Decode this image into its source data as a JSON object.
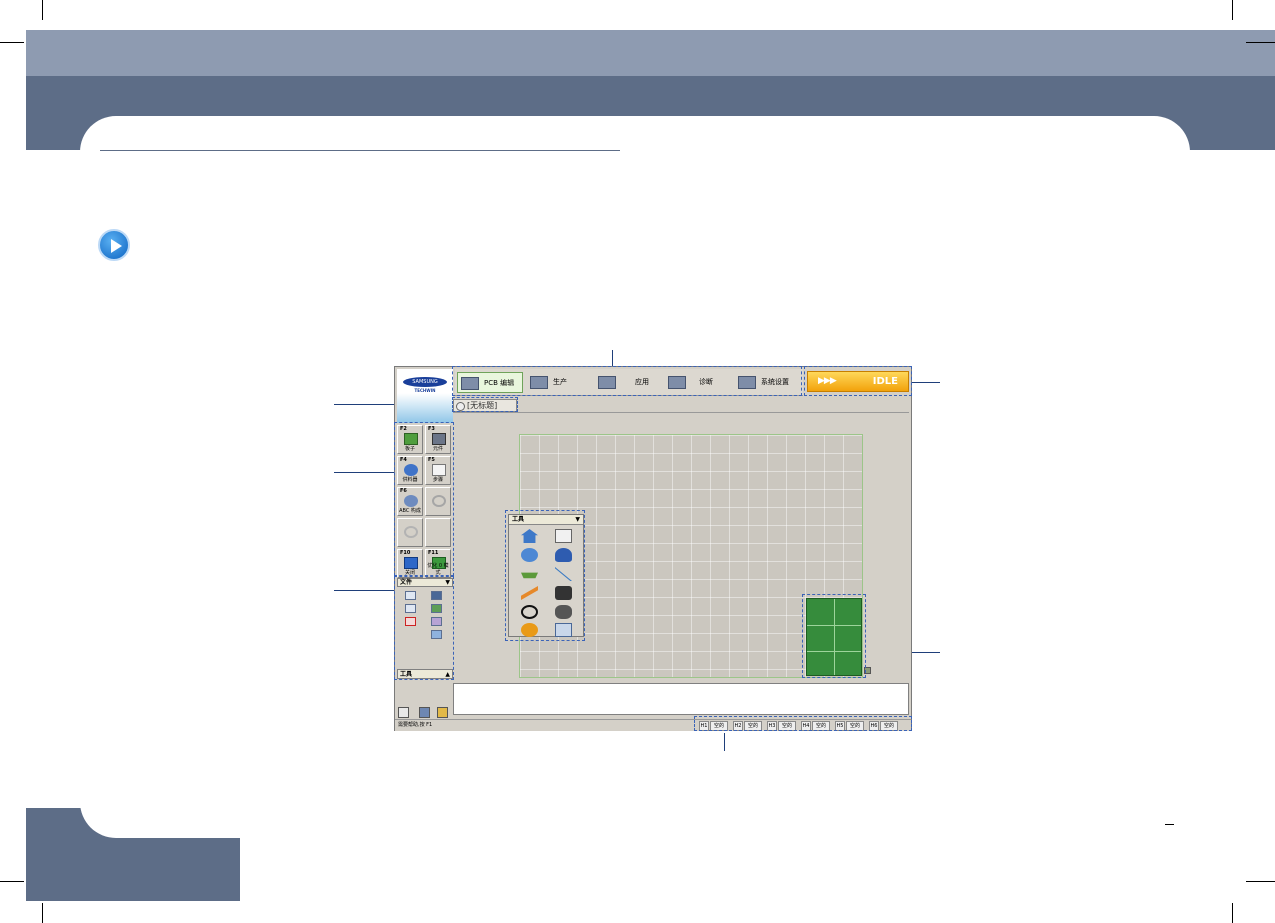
{
  "app": {
    "logo": {
      "brand": "SAMSUNG",
      "sub": "TECHWIN"
    },
    "tabs": [
      {
        "label": "PCB 编辑",
        "icon": "pcb-edit-icon",
        "active": true
      },
      {
        "label": "生产",
        "icon": "production-icon"
      },
      {
        "label": "应用",
        "icon": "application-icon"
      },
      {
        "label": "诊断",
        "icon": "diagnosis-icon"
      },
      {
        "label": "系统设置",
        "icon": "system-settings-icon"
      }
    ],
    "status_indicator": "IDLE",
    "doc_tab": "[无标题]",
    "fkeys": [
      {
        "key": "F2",
        "label": "板子",
        "icon": "board-icon"
      },
      {
        "key": "F3",
        "label": "元件",
        "icon": "part-icon"
      },
      {
        "key": "F4",
        "label": "供料器",
        "icon": "feeder-icon"
      },
      {
        "key": "F5",
        "label": "步骤",
        "icon": "step-icon"
      },
      {
        "key": "F6",
        "label": "ABC 构成",
        "icon": "abc-config-icon"
      },
      {
        "key": "F10",
        "label": "关闭",
        "icon": "close-icon"
      },
      {
        "key": "F11",
        "label": "优化 0 模式",
        "icon": "optimize-icon"
      }
    ],
    "file_panel": {
      "title": "文件"
    },
    "tools_panel": {
      "title": "工具"
    },
    "status_bar": {
      "help": "需要帮助,按 F1",
      "slots": [
        {
          "head": "H1",
          "value": "空的"
        },
        {
          "head": "H2",
          "value": "空的"
        },
        {
          "head": "H3",
          "value": "空的"
        },
        {
          "head": "H4",
          "value": "空的"
        },
        {
          "head": "H5",
          "value": "空的"
        },
        {
          "head": "H6",
          "value": "空的"
        }
      ]
    }
  },
  "colors": {
    "band_light": "#8e9bb1",
    "band_dark": "#5d6d87",
    "idle_orange": "#f2a20c",
    "minimap_green": "#368c3c",
    "callout_blue": "#1f3f7a"
  }
}
